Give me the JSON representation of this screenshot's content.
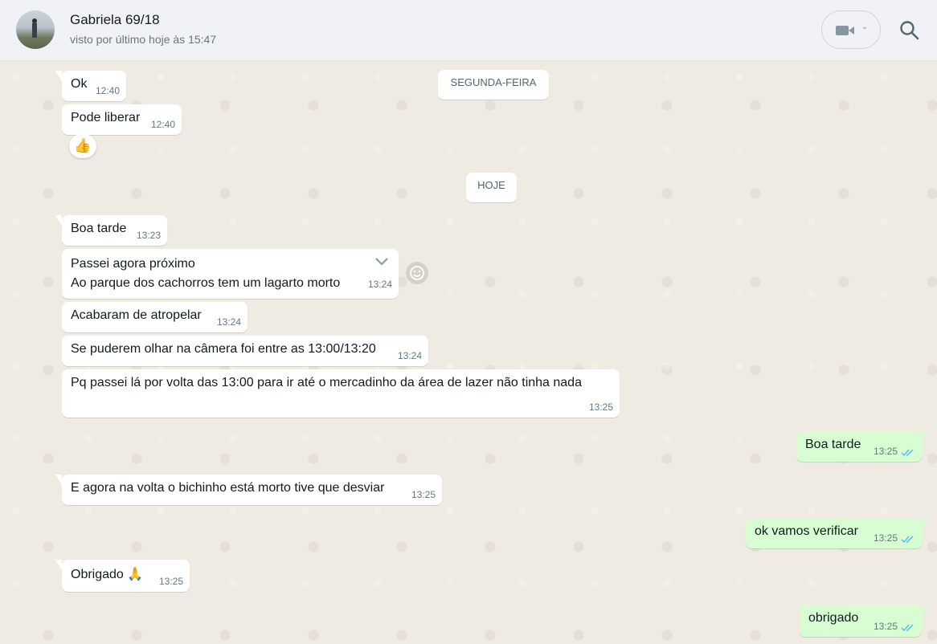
{
  "header": {
    "contact_name": "Gabriela 69/18",
    "last_seen": "visto por último hoje às 15:47"
  },
  "day_separators": {
    "monday": "SEGUNDA-FEIRA",
    "today": "HOJE"
  },
  "messages": [
    {
      "text": "Ok",
      "time": "12:40",
      "direction": "in"
    },
    {
      "text": "Pode liberar",
      "time": "12:40",
      "direction": "in",
      "reaction": "👍"
    },
    {
      "text": "Boa tarde",
      "time": "13:23",
      "direction": "in"
    },
    {
      "line1": "Passei agora próximo",
      "line2": "Ao parque dos cachorros tem um lagarto morto",
      "time": "13:24",
      "direction": "in"
    },
    {
      "text": "Acabaram de atropelar",
      "time": "13:24",
      "direction": "in"
    },
    {
      "text": "Se puderem olhar na câmera foi entre as 13:00/13:20",
      "time": "13:24",
      "direction": "in"
    },
    {
      "text": "Pq passei lá por volta das 13:00 para ir até o mercadinho da área de lazer não tinha nada",
      "time": "13:25",
      "direction": "in"
    },
    {
      "text": "Boa tarde",
      "time": "13:25",
      "direction": "out",
      "status": "read"
    },
    {
      "text": "E agora na volta o bichinho está morto tive que desviar",
      "time": "13:25",
      "direction": "in"
    },
    {
      "text": "ok vamos verificar",
      "time": "13:25",
      "direction": "out",
      "status": "read"
    },
    {
      "text": "Obrigado 🙏",
      "time": "13:25",
      "direction": "in"
    },
    {
      "text": "obrigado",
      "time": "13:25",
      "direction": "out",
      "status": "read"
    }
  ],
  "colors": {
    "incoming_bubble": "#ffffff",
    "outgoing_bubble": "#d9fdd3",
    "read_ticks": "#53bdeb",
    "chat_background": "#efeae2",
    "header_background": "#f0f2f5"
  },
  "icons": {
    "video_call": "video-camera-icon",
    "search": "search-icon",
    "emoji_reaction": "emoji-icon",
    "message_menu": "chevron-down-icon",
    "read_status": "double-check-icon"
  }
}
